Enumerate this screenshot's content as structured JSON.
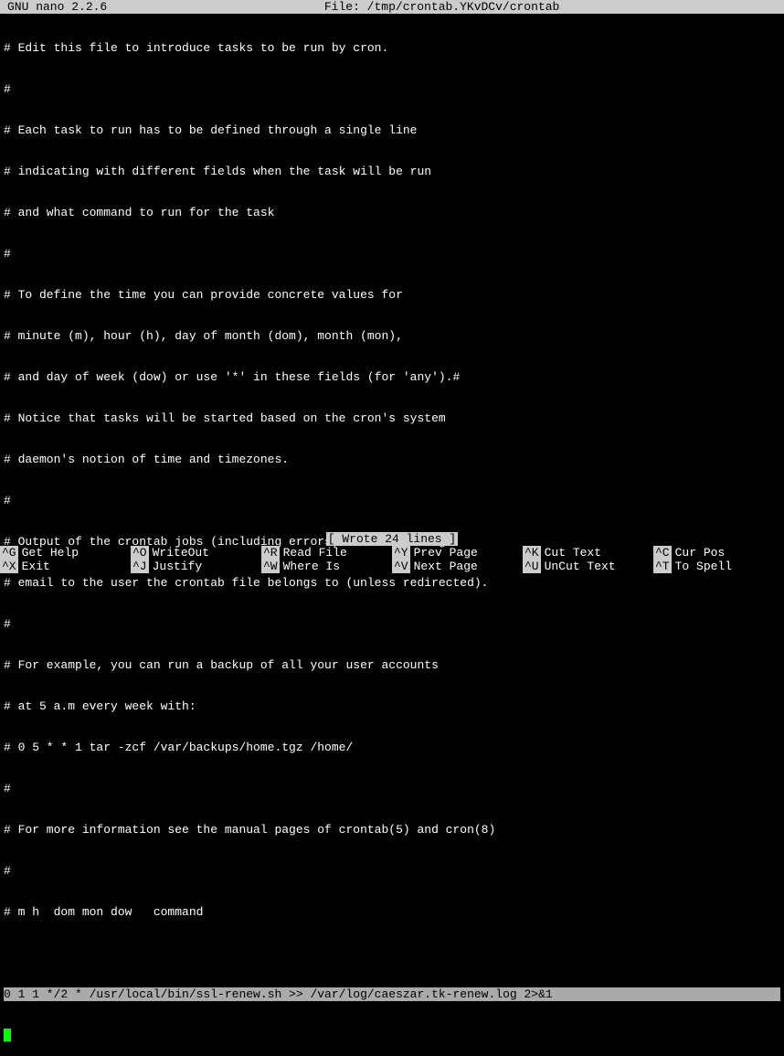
{
  "header": {
    "app": "GNU nano 2.2.6",
    "file_label": "File: /tmp/crontab.YKvDCv/crontab"
  },
  "lines": [
    "# Edit this file to introduce tasks to be run by cron.",
    "#",
    "# Each task to run has to be defined through a single line",
    "# indicating with different fields when the task will be run",
    "# and what command to run for the task",
    "#",
    "# To define the time you can provide concrete values for",
    "# minute (m), hour (h), day of month (dom), month (mon),",
    "# and day of week (dow) or use '*' in these fields (for 'any').#",
    "# Notice that tasks will be started based on the cron's system",
    "# daemon's notion of time and timezones.",
    "#",
    "# Output of the crontab jobs (including errors) is sent through",
    "# email to the user the crontab file belongs to (unless redirected).",
    "#",
    "# For example, you can run a backup of all your user accounts",
    "# at 5 a.m every week with:",
    "# 0 5 * * 1 tar -zcf /var/backups/home.tgz /home/",
    "#",
    "# For more information see the manual pages of crontab(5) and cron(8)",
    "#",
    "# m h  dom mon dow   command",
    ""
  ],
  "highlighted_line": "0 1 1 */2 * /usr/local/bin/ssl-renew.sh >> /var/log/caeszar.tk-renew.log 2>&1",
  "status": "[ Wrote 24 lines ]",
  "shortcuts": {
    "row1": [
      {
        "key": "^G",
        "label": "Get Help"
      },
      {
        "key": "^O",
        "label": "WriteOut"
      },
      {
        "key": "^R",
        "label": "Read File"
      },
      {
        "key": "^Y",
        "label": "Prev Page"
      },
      {
        "key": "^K",
        "label": "Cut Text"
      },
      {
        "key": "^C",
        "label": "Cur Pos"
      }
    ],
    "row2": [
      {
        "key": "^X",
        "label": "Exit"
      },
      {
        "key": "^J",
        "label": "Justify"
      },
      {
        "key": "^W",
        "label": "Where Is"
      },
      {
        "key": "^V",
        "label": "Next Page"
      },
      {
        "key": "^U",
        "label": "UnCut Text"
      },
      {
        "key": "^T",
        "label": "To Spell"
      }
    ]
  }
}
